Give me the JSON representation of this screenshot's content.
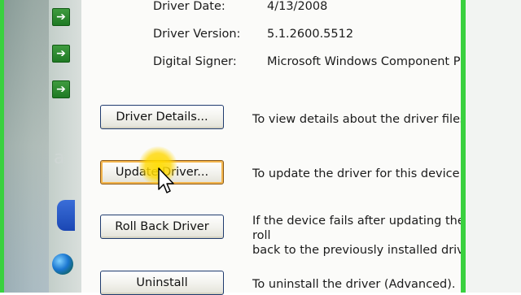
{
  "driver_info": {
    "date_label": "Driver Date:",
    "date_value": "4/13/2008",
    "version_label": "Driver Version:",
    "version_value": "5.1.2600.5512",
    "signer_label": "Digital Signer:",
    "signer_value": "Microsoft Windows Component Publisher"
  },
  "buttons": {
    "details": "Driver Details...",
    "update": "Update Driver...",
    "rollback": "Roll Back Driver",
    "uninstall": "Uninstall"
  },
  "descriptions": {
    "details": "To view details about the driver files.",
    "update": "To update the driver for this device.",
    "rollback_line1": "If the device fails after updating the driver, roll",
    "rollback_line2": "back to the previously installed driver.",
    "uninstall": "To uninstall the driver (Advanced)."
  },
  "icons": {
    "left_arrows": [
      "arrow-right-icon",
      "arrow-right-icon",
      "arrow-right-icon"
    ],
    "cursor": "mouse-pointer-icon",
    "globe": "internet-explorer-icon",
    "blue": "windows-media-icon"
  },
  "colors": {
    "window_border": "#3ad13f",
    "button_border": "#1f3b6e",
    "hot_button_border": "#f3b54d",
    "cursor_highlight": "#ffd700"
  }
}
